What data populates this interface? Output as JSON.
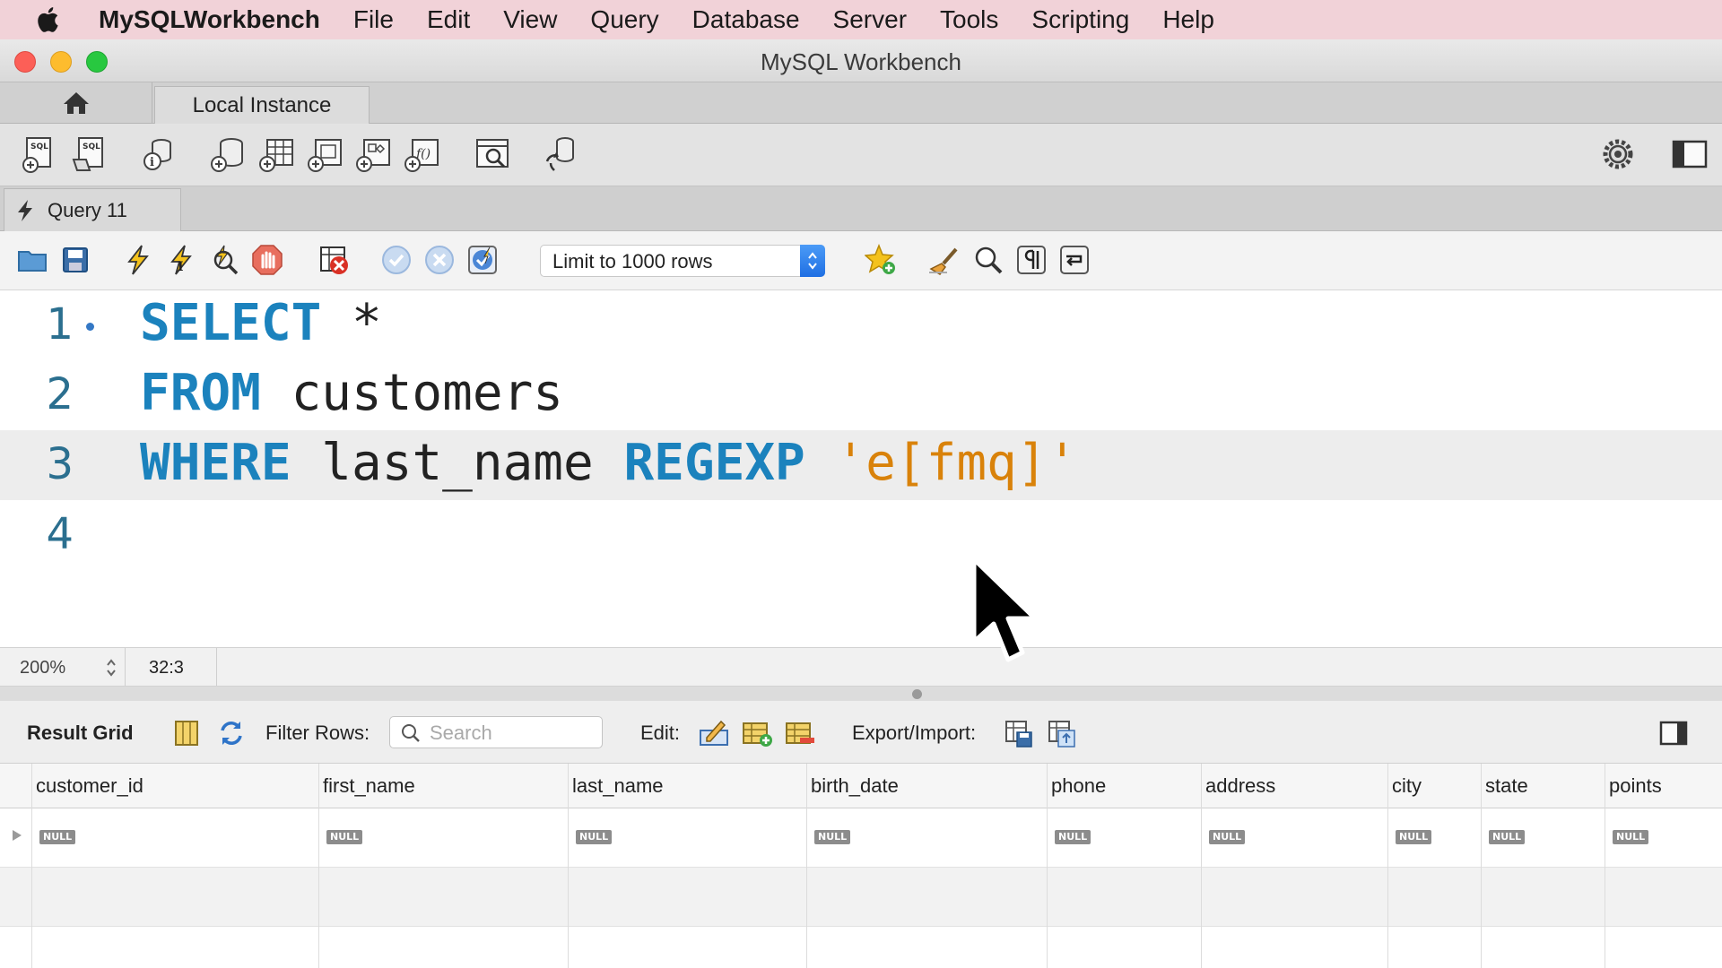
{
  "menubar": {
    "app": "MySQLWorkbench",
    "items": [
      "File",
      "Edit",
      "View",
      "Query",
      "Database",
      "Server",
      "Tools",
      "Scripting",
      "Help"
    ]
  },
  "window": {
    "title": "MySQL Workbench"
  },
  "connection_tab": {
    "label": "Local Instance"
  },
  "query_tab": {
    "label": "Query 11"
  },
  "editor_toolbar": {
    "limit_select": "Limit to 1000 rows"
  },
  "editor": {
    "lines": [
      {
        "num": "1",
        "tokens": [
          [
            "kw",
            "SELECT"
          ],
          [
            "id",
            " *"
          ]
        ]
      },
      {
        "num": "2",
        "tokens": [
          [
            "kw",
            "FROM"
          ],
          [
            "id",
            " customers"
          ]
        ]
      },
      {
        "num": "3",
        "tokens": [
          [
            "kw",
            "WHERE"
          ],
          [
            "id",
            " last_name "
          ],
          [
            "kw",
            "REGEXP"
          ],
          [
            "str",
            " 'e[fmq]'"
          ]
        ]
      },
      {
        "num": "4",
        "tokens": []
      }
    ]
  },
  "status": {
    "zoom": "200%",
    "position": "32:3"
  },
  "results": {
    "title": "Result Grid",
    "filter_label": "Filter Rows:",
    "search_placeholder": "Search",
    "edit_label": "Edit:",
    "export_label": "Export/Import:",
    "columns": [
      "customer_id",
      "first_name",
      "last_name",
      "birth_date",
      "phone",
      "address",
      "city",
      "state",
      "points"
    ],
    "null_label": "NULL"
  },
  "colors": {
    "keyword": "#1b82bd",
    "string": "#d9820a",
    "line_number": "#2b6f8f"
  }
}
